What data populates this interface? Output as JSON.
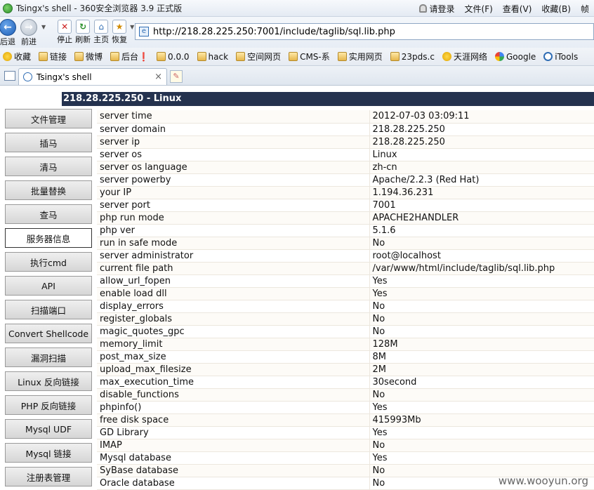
{
  "window": {
    "title": "Tsingx's shell - 360安全浏览器 3.9 正式版",
    "menus": [
      "请登录",
      "文件(F)",
      "查看(V)",
      "收藏(B)",
      "帧"
    ]
  },
  "navbar": {
    "back_label": "后退",
    "forward_label": "前进",
    "stop_label": "停止",
    "refresh_label": "刷新",
    "home_label": "主页",
    "restore_label": "恢复",
    "address": "http://218.28.225.250:7001/include/taglib/sql.lib.php"
  },
  "bookmarks": [
    {
      "label": "收藏",
      "icon": "star-icon"
    },
    {
      "label": "链接",
      "icon": "folder-icon"
    },
    {
      "label": "微博",
      "icon": "folder-icon"
    },
    {
      "label": "后台❗",
      "icon": "folder-icon"
    },
    {
      "label": "0.0.0",
      "icon": "folder-icon"
    },
    {
      "label": "hack",
      "icon": "folder-icon"
    },
    {
      "label": "空间网页",
      "icon": "folder-icon"
    },
    {
      "label": "CMS-系",
      "icon": "folder-icon"
    },
    {
      "label": "实用网页",
      "icon": "folder-icon"
    },
    {
      "label": "23pds.c",
      "icon": "folder-icon"
    },
    {
      "label": "天涯网络",
      "icon": "star-icon"
    },
    {
      "label": "Google",
      "icon": "google-icon"
    },
    {
      "label": "iTools",
      "icon": "ie-icon"
    }
  ],
  "tab": {
    "title": "Tsingx's shell",
    "close": "×"
  },
  "page": {
    "host_header": "218.28.225.250 - Linux",
    "nav": [
      "文件管理",
      "插马",
      "清马",
      "批量替换",
      "查马",
      "服务器信息",
      "执行cmd",
      "API",
      "扫描端口",
      "Convert Shellcode",
      "漏洞扫描",
      "Linux 反向链接",
      "PHP 反向链接",
      "Mysql UDF",
      "Mysql 链接",
      "注册表管理"
    ],
    "active_nav": 5,
    "info": [
      [
        "server time",
        "2012-07-03 03:09:11"
      ],
      [
        "server domain",
        "218.28.225.250"
      ],
      [
        "server ip",
        "218.28.225.250"
      ],
      [
        "server os",
        "Linux"
      ],
      [
        "server os language",
        "zh-cn"
      ],
      [
        "server powerby",
        "Apache/2.2.3 (Red Hat)"
      ],
      [
        "your IP",
        "1.194.36.231"
      ],
      [
        "server port",
        "7001"
      ],
      [
        "php run mode",
        "APACHE2HANDLER"
      ],
      [
        "php ver",
        "5.1.6"
      ],
      [
        "run in safe mode",
        "No"
      ],
      [
        "server administrator",
        "root@localhost"
      ],
      [
        "current file path",
        "/var/www/html/include/taglib/sql.lib.php"
      ],
      [
        "allow_url_fopen",
        "Yes"
      ],
      [
        "enable load dll",
        "Yes"
      ],
      [
        "display_errors",
        "No"
      ],
      [
        "register_globals",
        "No"
      ],
      [
        "magic_quotes_gpc",
        "No"
      ],
      [
        "memory_limit",
        "128M"
      ],
      [
        "post_max_size",
        "8M"
      ],
      [
        "upload_max_filesize",
        "2M"
      ],
      [
        "max_execution_time",
        "30second"
      ],
      [
        "disable_functions",
        "No"
      ],
      [
        "phpinfo()",
        "Yes"
      ],
      [
        "free disk space",
        "415993Mb"
      ],
      [
        "GD Library",
        "Yes"
      ],
      [
        "IMAP",
        "No"
      ],
      [
        "Mysql database",
        "Yes"
      ],
      [
        "SyBase database",
        "No"
      ],
      [
        "Oracle database",
        "No"
      ]
    ]
  },
  "watermark": "www.wooyun.org"
}
